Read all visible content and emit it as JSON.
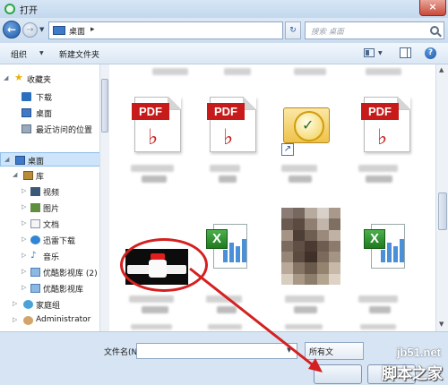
{
  "window": {
    "title": "打开",
    "close_label": "×"
  },
  "address": {
    "location": "桌面",
    "chevron": "▸",
    "search_placeholder": "搜索 桌面"
  },
  "toolbar": {
    "organize_label": "组织",
    "new_folder_label": "新建文件夹",
    "help_label": "?"
  },
  "nav": {
    "favorites_label": "收藏夹",
    "favorites": [
      "下载",
      "桌面",
      "最近访问的位置"
    ],
    "desktop_label": "桌面",
    "library_label": "库",
    "libraries": [
      "视频",
      "图片",
      "文档",
      "迅雷下载",
      "音乐",
      "优酷影视库 (2)",
      "优酷影视库"
    ],
    "homegroup_label": "家庭组",
    "user_label": "Administrator"
  },
  "files": {
    "pdf_badge": "PDF",
    "excel_badge": "X"
  },
  "bottom": {
    "filename_label": "文件名(N):",
    "filetype_value": "所有文"
  },
  "watermark": {
    "url": "jb51.net",
    "site": "脚本之家"
  },
  "colors": {
    "annotation_red": "#d42020",
    "pdf_red": "#c71a1a",
    "excel_green": "#1e7b1e"
  },
  "icons": {
    "back": "back-arrow-icon",
    "forward": "forward-arrow-icon",
    "refresh": "refresh-icon",
    "search": "search-icon",
    "view": "view-icon",
    "pane": "preview-pane-icon",
    "help": "help-icon"
  }
}
